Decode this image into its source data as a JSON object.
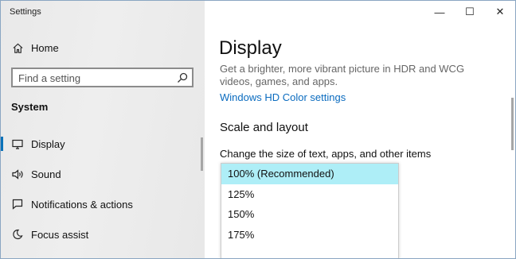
{
  "window": {
    "title": "Settings",
    "controls": {
      "minimize": "—",
      "maximize": "☐",
      "close": "✕"
    }
  },
  "sidebar": {
    "home_label": "Home",
    "search_placeholder": "Find a setting",
    "section_title": "System",
    "items": [
      {
        "label": "Display",
        "icon": "monitor-icon",
        "selected": true
      },
      {
        "label": "Sound",
        "icon": "speaker-icon",
        "selected": false
      },
      {
        "label": "Notifications & actions",
        "icon": "notifications-icon",
        "selected": false
      },
      {
        "label": "Focus assist",
        "icon": "moon-icon",
        "selected": false
      }
    ]
  },
  "main": {
    "title": "Display",
    "description": "Get a brighter, more vibrant picture in HDR and WCG videos, games, and apps.",
    "link": "Windows HD Color settings",
    "section_title": "Scale and layout",
    "scale_label": "Change the size of text, apps, and other items",
    "scale_options": [
      "100% (Recommended)",
      "125%",
      "150%",
      "175%"
    ],
    "selected_option": "100% (Recommended)"
  },
  "colors": {
    "accent": "#0a72b9",
    "link": "#0a6bbf",
    "selected_option_bg": "#aeeef7",
    "sidebar_bg": "#ebebeb"
  }
}
